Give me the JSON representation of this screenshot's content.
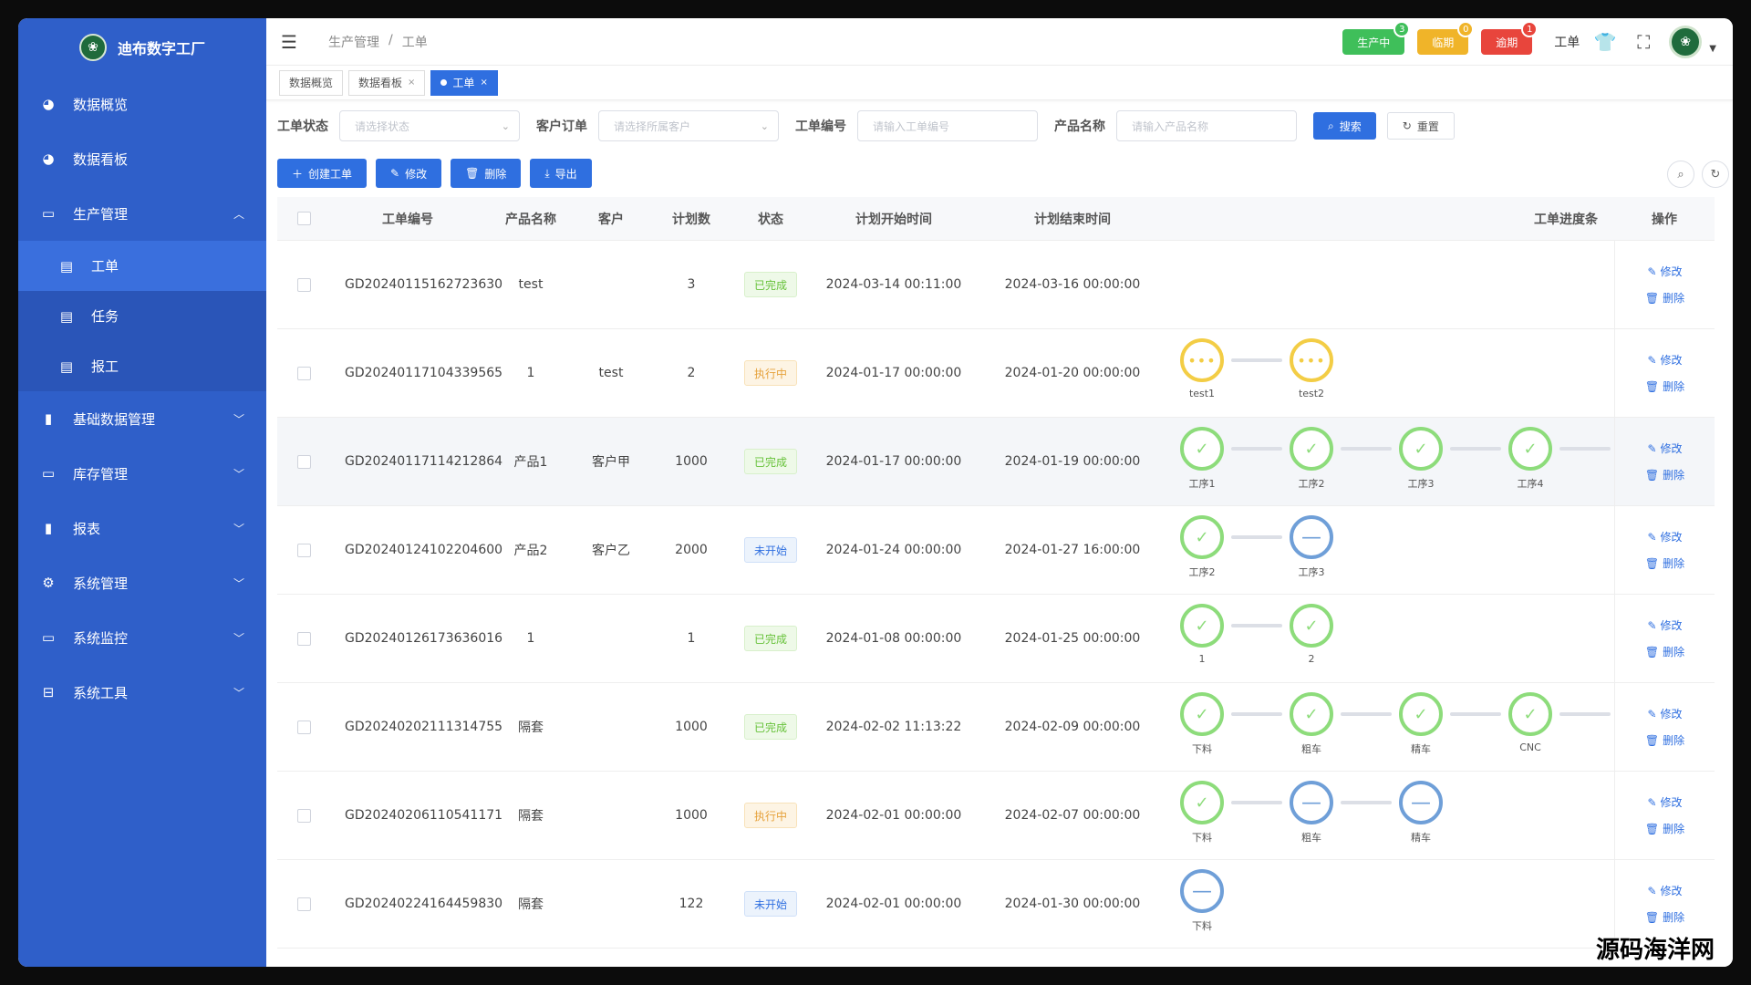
{
  "brand": {
    "name": "迪布数字工厂"
  },
  "sidebar": {
    "items": [
      {
        "label": "数据概览",
        "icon": "dashboard-icon"
      },
      {
        "label": "数据看板",
        "icon": "dashboard-icon"
      },
      {
        "label": "生产管理",
        "icon": "monitor-icon",
        "expanded": true,
        "children": [
          {
            "label": "工单",
            "icon": "document-icon",
            "active": true
          },
          {
            "label": "任务",
            "icon": "document-icon"
          },
          {
            "label": "报工",
            "icon": "document-icon"
          }
        ]
      },
      {
        "label": "基础数据管理",
        "icon": "book-icon"
      },
      {
        "label": "库存管理",
        "icon": "monitor-icon"
      },
      {
        "label": "报表",
        "icon": "book-icon"
      },
      {
        "label": "系统管理",
        "icon": "gear-icon"
      },
      {
        "label": "系统监控",
        "icon": "monitor-icon"
      },
      {
        "label": "系统工具",
        "icon": "toolbox-icon"
      }
    ]
  },
  "breadcrumb": {
    "parent": "生产管理",
    "sep": "/",
    "current": "工单"
  },
  "topbar": {
    "pills": [
      {
        "label": "生产中",
        "count": "3",
        "color": "#3fbf5a"
      },
      {
        "label": "临期",
        "count": "0",
        "color": "#f0b429"
      },
      {
        "label": "逾期",
        "count": "1",
        "color": "#e8453c"
      }
    ],
    "text": "工单"
  },
  "tabs": [
    {
      "label": "数据概览",
      "closable": false,
      "active": false
    },
    {
      "label": "数据看板",
      "closable": true,
      "active": false
    },
    {
      "label": "工单",
      "closable": true,
      "active": true
    }
  ],
  "filters": {
    "status_label": "工单状态",
    "status_placeholder": "请选择状态",
    "order_label": "客户订单",
    "order_placeholder": "请选择所属客户",
    "no_label": "工单编号",
    "no_placeholder": "请输入工单编号",
    "product_label": "产品名称",
    "product_placeholder": "请输入产品名称",
    "search": "搜索",
    "reset": "重置"
  },
  "actions": {
    "create": "创建工单",
    "edit": "修改",
    "delete": "删除",
    "export": "导出"
  },
  "table": {
    "headers": {
      "no": "工单编号",
      "product": "产品名称",
      "customer": "客户",
      "plan": "计划数",
      "status": "状态",
      "start": "计划开始时间",
      "end": "计划结束时间",
      "progress": "工单进度条",
      "op": "操作"
    },
    "op_edit": "修改",
    "op_delete": "删除",
    "rows": [
      {
        "no": "GD20240115162723630",
        "product": "test",
        "customer": "",
        "plan": "3",
        "status": "已完成",
        "status_type": "done",
        "start": "2024-03-14 00:11:00",
        "end": "2024-03-16 00:00:00",
        "steps": []
      },
      {
        "no": "GD20240117104339565",
        "product": "1",
        "customer": "test",
        "plan": "2",
        "status": "执行中",
        "status_type": "run",
        "start": "2024-01-17 00:00:00",
        "end": "2024-01-20 00:00:00",
        "steps": [
          {
            "label": "test1",
            "state": "doing"
          },
          {
            "label": "test2",
            "state": "doing"
          }
        ]
      },
      {
        "no": "GD20240117114212864",
        "product": "产品1",
        "customer": "客户甲",
        "plan": "1000",
        "status": "已完成",
        "status_type": "done",
        "start": "2024-01-17 00:00:00",
        "end": "2024-01-19 00:00:00",
        "steps": [
          {
            "label": "工序1",
            "state": "ok"
          },
          {
            "label": "工序2",
            "state": "ok"
          },
          {
            "label": "工序3",
            "state": "ok"
          },
          {
            "label": "工序4",
            "state": "ok"
          }
        ]
      },
      {
        "no": "GD20240124102204600",
        "product": "产品2",
        "customer": "客户乙",
        "plan": "2000",
        "status": "未开始",
        "status_type": "todo",
        "start": "2024-01-24 00:00:00",
        "end": "2024-01-27 16:00:00",
        "steps": [
          {
            "label": "工序2",
            "state": "ok"
          },
          {
            "label": "工序3",
            "state": "wait"
          }
        ]
      },
      {
        "no": "GD20240126173636016",
        "product": "1",
        "customer": "",
        "plan": "1",
        "status": "已完成",
        "status_type": "done",
        "start": "2024-01-08 00:00:00",
        "end": "2024-01-25 00:00:00",
        "steps": [
          {
            "label": "1",
            "state": "ok"
          },
          {
            "label": "2",
            "state": "ok"
          }
        ]
      },
      {
        "no": "GD20240202111314755",
        "product": "隔套",
        "customer": "",
        "plan": "1000",
        "status": "已完成",
        "status_type": "done",
        "start": "2024-02-02 11:13:22",
        "end": "2024-02-09 00:00:00",
        "steps": [
          {
            "label": "下料",
            "state": "ok"
          },
          {
            "label": "粗车",
            "state": "ok"
          },
          {
            "label": "精车",
            "state": "ok"
          },
          {
            "label": "CNC",
            "state": "ok"
          }
        ]
      },
      {
        "no": "GD20240206110541171",
        "product": "隔套",
        "customer": "",
        "plan": "1000",
        "status": "执行中",
        "status_type": "run",
        "start": "2024-02-01 00:00:00",
        "end": "2024-02-07 00:00:00",
        "steps": [
          {
            "label": "下料",
            "state": "ok"
          },
          {
            "label": "粗车",
            "state": "wait"
          },
          {
            "label": "精车",
            "state": "wait"
          }
        ]
      },
      {
        "no": "GD20240224164459830",
        "product": "隔套",
        "customer": "",
        "plan": "122",
        "status": "未开始",
        "status_type": "todo",
        "start": "2024-02-01 00:00:00",
        "end": "2024-01-30 00:00:00",
        "steps": [
          {
            "label": "下料",
            "state": "wait"
          }
        ]
      }
    ]
  },
  "watermark": "源码海洋网"
}
